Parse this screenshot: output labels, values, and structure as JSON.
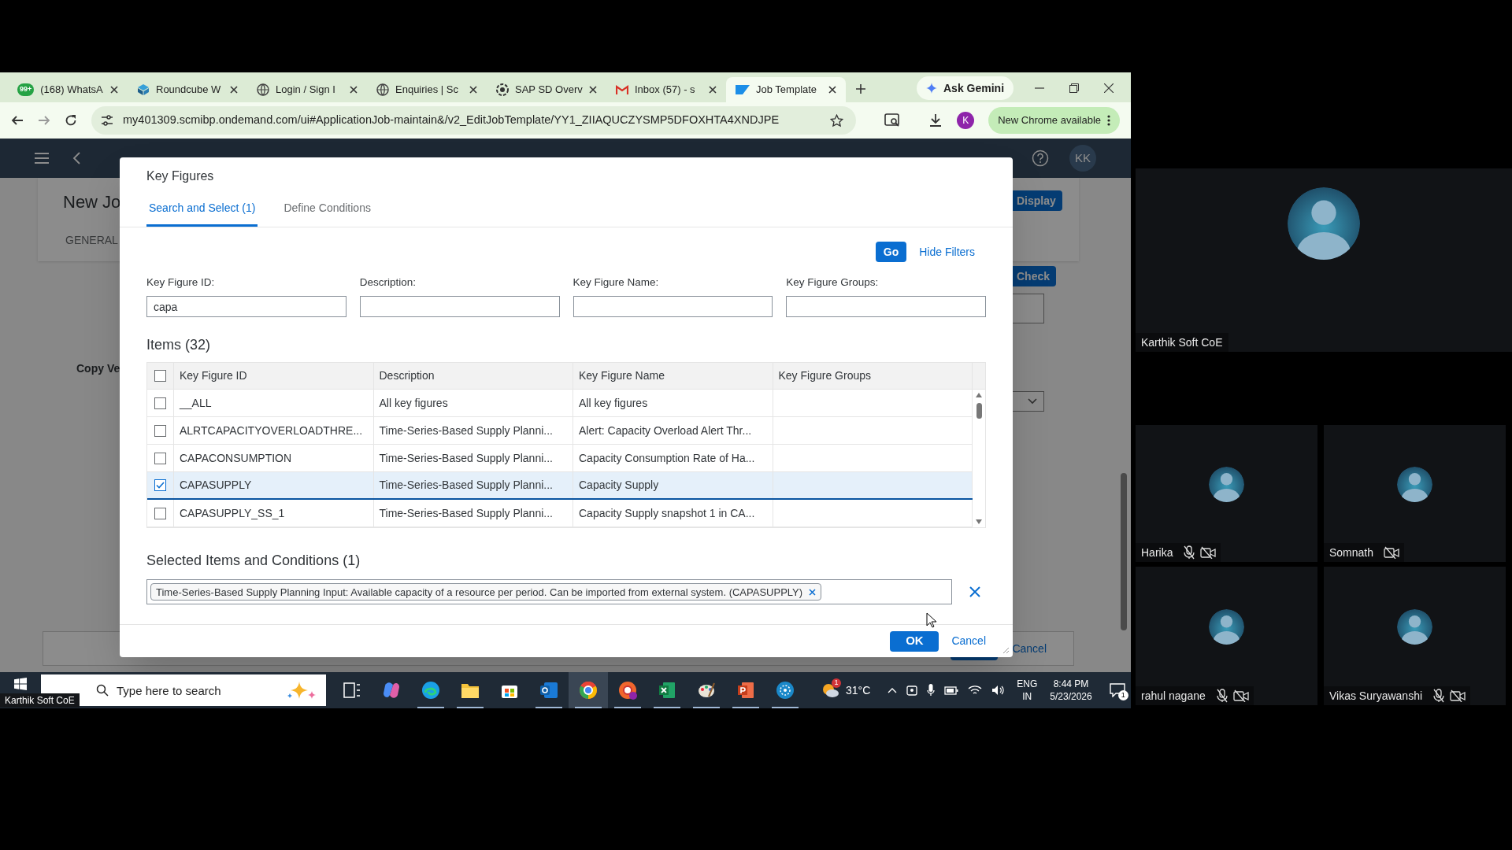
{
  "browser": {
    "tabs": [
      {
        "title": "(168) WhatsA",
        "badge": "99+",
        "selected": false
      },
      {
        "title": "Roundcube W",
        "selected": false
      },
      {
        "title": "Login / Sign I",
        "selected": false
      },
      {
        "title": "Enquiries | Sc",
        "selected": false
      },
      {
        "title": "SAP SD Overv",
        "selected": false
      },
      {
        "title": "Inbox (57) - s",
        "selected": false
      },
      {
        "title": "Job Template",
        "selected": true
      }
    ],
    "ask_gemini": "Ask Gemini",
    "url": "my401309.scmibp.ondemand.com/ui#ApplicationJob-maintain&/v2_EditJobTemplate/YY1_ZIIAQUCZYSMP5DFOXHTA4XNDJPE",
    "profile": "K",
    "update_notice": "New Chrome available"
  },
  "app": {
    "avatar": "KK",
    "page_title": "New Jo",
    "section_tab": "GENERAL",
    "field_label": "Copy Ve",
    "display_button": "Display",
    "check_button": "Check",
    "cancel_button": "Cancel"
  },
  "dialog": {
    "title": "Key Figures",
    "tabs": [
      {
        "label": "Search and Select (1)",
        "selected": true
      },
      {
        "label": "Define Conditions",
        "selected": false
      }
    ],
    "go_button": "Go",
    "hide_filters": "Hide Filters",
    "filters": [
      {
        "label": "Key Figure ID:",
        "value": "capa"
      },
      {
        "label": "Description:"
      },
      {
        "label": "Key Figure Name:"
      },
      {
        "label": "Key Figure Groups:"
      }
    ],
    "items_title": "Items (32)",
    "table": {
      "all_checked": false,
      "columns": [
        "Key Figure ID",
        "Description",
        "Key Figure Name",
        "Key Figure Groups"
      ],
      "rows": [
        {
          "id": "__ALL",
          "description": "All key figures",
          "name": "All key figures",
          "selected": false
        },
        {
          "id": "ALRTCAPACITYOVERLOADTHRE...",
          "description": "Time-Series-Based Supply Planni...",
          "name": "Alert: Capacity Overload Alert Thr...",
          "selected": false
        },
        {
          "id": "CAPACONSUMPTION",
          "description": "Time-Series-Based Supply Planni...",
          "name": "Capacity Consumption Rate of Ha...",
          "selected": false
        },
        {
          "id": "CAPASUPPLY",
          "description": "Time-Series-Based Supply Planni...",
          "name": "Capacity Supply",
          "selected": true
        },
        {
          "id": "CAPASUPPLY_SS_1",
          "description": "Time-Series-Based Supply Planni...",
          "name": "Capacity Supply snapshot 1 in CA...",
          "selected": false
        }
      ]
    },
    "selected_title": "Selected Items and Conditions (1)",
    "tokens": [
      "Time-Series-Based Supply Planning Input: Available capacity of a resource per period. Can be imported from external system. (CAPASUPPLY)"
    ],
    "ok_button": "OK",
    "cancel_button": "Cancel"
  },
  "taskbar": {
    "search_placeholder": "Type here to search",
    "apps": [
      {
        "running": false,
        "selected": false
      },
      {
        "running": false,
        "selected": false
      },
      {
        "running": true,
        "selected": false
      },
      {
        "running": true,
        "selected": false
      },
      {
        "running": false,
        "selected": false
      },
      {
        "running": true,
        "selected": false
      },
      {
        "running": true,
        "selected": true
      },
      {
        "running": true,
        "selected": false
      },
      {
        "running": true,
        "selected": false
      },
      {
        "running": true,
        "selected": false
      },
      {
        "running": true,
        "selected": false
      },
      {
        "running": true,
        "selected": false
      }
    ],
    "weather_badge": "1",
    "temperature": "31°C",
    "language": "ENG",
    "region": "IN",
    "time": "8:44 PM",
    "date": "5/23/2026",
    "notification_count": "1"
  },
  "presenter_label": "Karthik Soft CoE",
  "participants": [
    {
      "name": "Karthik Soft CoE",
      "mic_muted": false,
      "camera_off": false
    },
    {
      "name": "Harika",
      "mic_muted": true,
      "camera_off": true
    },
    {
      "name": "Somnath",
      "mic_muted": false,
      "camera_off": true
    },
    {
      "name": "rahul nagane",
      "mic_muted": true,
      "camera_off": true
    },
    {
      "name": "Vikas Suryawanshi",
      "mic_muted": true,
      "camera_off": true
    }
  ]
}
